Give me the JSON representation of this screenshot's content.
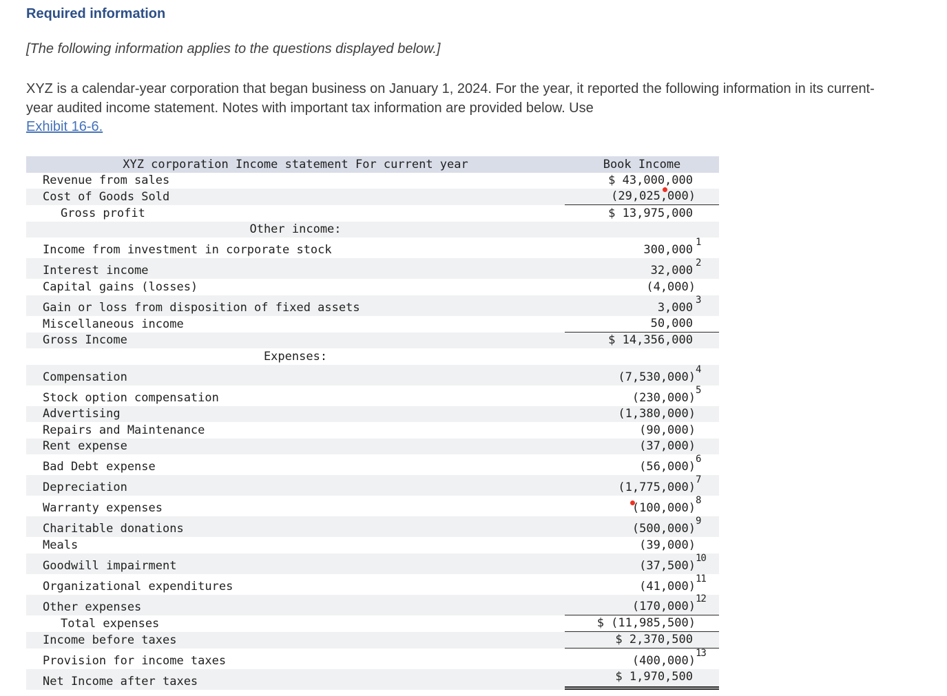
{
  "header": {
    "required_info_label": "Required information",
    "applies_note": "[The following information applies to the questions displayed below.]"
  },
  "intro": {
    "text": "XYZ is a calendar-year corporation that began business on January 1, 2024. For the year, it reported the following information in its current-year audited income statement. Notes with important tax information are provided below. Use",
    "link_label": "Exhibit 16-6."
  },
  "colors": {
    "heading_blue": "#2d4f87",
    "link_blue": "#4472b8",
    "table_header_bg": "#d9dde8",
    "alt_row_bg": "#f0f1f2",
    "red_marker": "#ee3224"
  },
  "table": {
    "title": "XYZ corporation Income statement For current year",
    "value_column_header": "Book Income",
    "rows": [
      {
        "label": "Revenue from sales",
        "value": "$ 43,000,000"
      },
      {
        "label": "Cost of Goods Sold",
        "value": "(29,025,000)",
        "underline": "single",
        "marker": "comma"
      },
      {
        "label": "Gross profit",
        "value": "$ 13,975,000",
        "indent": true
      },
      {
        "label": "Other income:",
        "section": true
      },
      {
        "label": "Income from investment in corporate stock",
        "value": "300,000",
        "sup": "1"
      },
      {
        "label": "Interest income",
        "value": "32,000",
        "sup": "2"
      },
      {
        "label": "Capital gains (losses)",
        "value": "(4,000)"
      },
      {
        "label": "Gain or loss from disposition of fixed assets",
        "value": "3,000",
        "sup": "3"
      },
      {
        "label": "Miscellaneous income",
        "value": "50,000",
        "underline": "single"
      },
      {
        "label": "Gross Income",
        "value": "$ 14,356,000"
      },
      {
        "label": "Expenses:",
        "section": true
      },
      {
        "label": "Compensation",
        "value": "(7,530,000)",
        "sup": "4"
      },
      {
        "label": "Stock option compensation",
        "value": "(230,000)",
        "sup": "5"
      },
      {
        "label": "Advertising",
        "value": "(1,380,000)"
      },
      {
        "label": "Repairs and Maintenance",
        "value": "(90,000)"
      },
      {
        "label": "Rent expense",
        "value": "(37,000)"
      },
      {
        "label": "Bad Debt expense",
        "value": "(56,000)",
        "sup": "6"
      },
      {
        "label": "Depreciation",
        "value": "(1,775,000)",
        "sup": "7"
      },
      {
        "label": "Warranty expenses",
        "value": "(100,000)",
        "sup": "8",
        "marker": "paren"
      },
      {
        "label": "Charitable donations",
        "value": "(500,000)",
        "sup": "9"
      },
      {
        "label": "Meals",
        "value": "(39,000)"
      },
      {
        "label": "Goodwill impairment",
        "value": "(37,500)",
        "sup": "10"
      },
      {
        "label": "Organizational expenditures",
        "value": "(41,000)",
        "sup": "11"
      },
      {
        "label": "Other expenses",
        "value": "(170,000)",
        "sup": "12",
        "underline": "single"
      },
      {
        "label": "Total expenses",
        "value": "$ (11,985,500)",
        "indent": true,
        "underline": "single"
      },
      {
        "label": "Income before taxes",
        "value": "$ 2,370,500",
        "underline": "single"
      },
      {
        "label": "Provision for income taxes",
        "value": "(400,000)",
        "sup": "13"
      },
      {
        "label": "Net Income after taxes",
        "value": "$ 1,970,500",
        "underline": "double"
      }
    ]
  }
}
